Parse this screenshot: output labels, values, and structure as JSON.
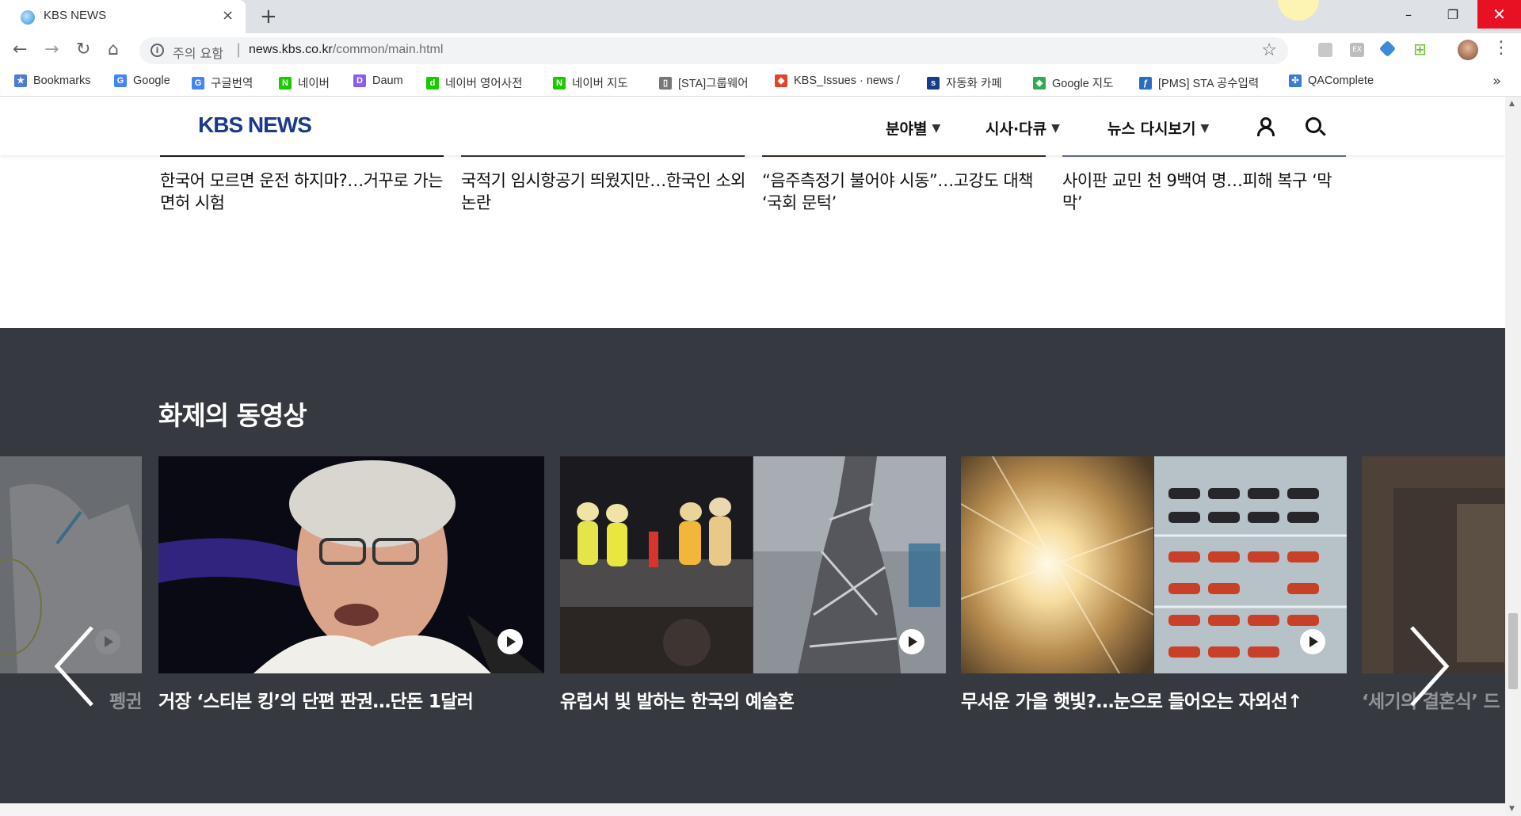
{
  "browser": {
    "tab_title": "KBS NEWS",
    "close_glyph": "×",
    "new_tab_glyph": "+",
    "security_label": "주의 요함",
    "url_host": "news.kbs.co.kr",
    "url_path": "/common/main.html",
    "window_controls": {
      "minimize": "–",
      "maximize": "❐",
      "close": "✕"
    },
    "icons": [
      "back-icon",
      "forward-icon",
      "reload-icon",
      "home-icon",
      "star-icon",
      "menu-icon"
    ]
  },
  "bookmarks": [
    {
      "label": "Bookmarks",
      "icon": "star-icon",
      "color": "#4a7bd8"
    },
    {
      "label": "Google",
      "icon": "google-icon",
      "color": "#4285f4"
    },
    {
      "label": "구글번역",
      "icon": "translate-icon",
      "color": "#4285f4"
    },
    {
      "label": "네이버",
      "icon": "naver-icon",
      "color": "#1ec800"
    },
    {
      "label": "Daum",
      "icon": "daum-icon",
      "color": "#8a5cf6"
    },
    {
      "label": "네이버 영어사전",
      "icon": "dict-icon",
      "color": "#1ec800"
    },
    {
      "label": "네이버 지도",
      "icon": "naver-icon",
      "color": "#1ec800"
    },
    {
      "label": "[STA]그룹웨어",
      "icon": "page-icon",
      "color": "#777777"
    },
    {
      "label": "KBS_Issues · news / ",
      "icon": "gitlab-icon",
      "color": "#e24329"
    },
    {
      "label": "자동화 카페",
      "icon": "sta-icon",
      "color": "#1a3a8a"
    },
    {
      "label": "Google 지도",
      "icon": "maps-icon",
      "color": "#34a853"
    },
    {
      "label": "[PMS] STA 공수입력",
      "icon": "pms-icon",
      "color": "#2a6ebd"
    },
    {
      "label": "QAComplete",
      "icon": "qa-icon",
      "color": "#3a7bd5"
    }
  ],
  "bookmarks_more": "»",
  "site": {
    "logo": "KBS NEWS",
    "nav": [
      {
        "label": "분야별",
        "caret": "▼"
      },
      {
        "label": "시사·다큐",
        "caret": "▼"
      },
      {
        "label": "뉴스 다시보기",
        "caret": "▼"
      }
    ]
  },
  "news_row": [
    {
      "title": "한국어 모르면 운전 하지마?…거꾸로 가는 면허 시험",
      "edge_color": "#1b1b1b"
    },
    {
      "title": "국적기 임시항공기 띄웠지만…한국인 소외 논란",
      "edge_color": "#3a3531"
    },
    {
      "title": "“음주측정기 불어야 시동”…고강도 대책 ‘국회 문턱’",
      "edge_color": "#3b2d1e"
    },
    {
      "title": "사이판 교민 천 9백여 명…피해 복구 ‘막막’",
      "edge_color": "#6a6f8a"
    }
  ],
  "video_section": {
    "title": "화제의 동영상",
    "prev_arrow": "previous-arrow-icon",
    "next_arrow": "next-arrow-icon",
    "cards": [
      {
        "title": "펭귄",
        "dimmed": true
      },
      {
        "title": "거장 ‘스티븐 킹’의 단편 판권…단돈 1달러",
        "dimmed": false
      },
      {
        "title": "유럽서 빛 발하는 한국의 예술혼",
        "dimmed": false
      },
      {
        "title": "무서운 가을 햇빛?…눈으로 들어오는 자외선↑",
        "dimmed": false
      },
      {
        "title": "‘세기의 결혼식’ 드",
        "dimmed": true
      }
    ]
  },
  "scrollbar": {
    "up": "▲",
    "down": "▼"
  }
}
